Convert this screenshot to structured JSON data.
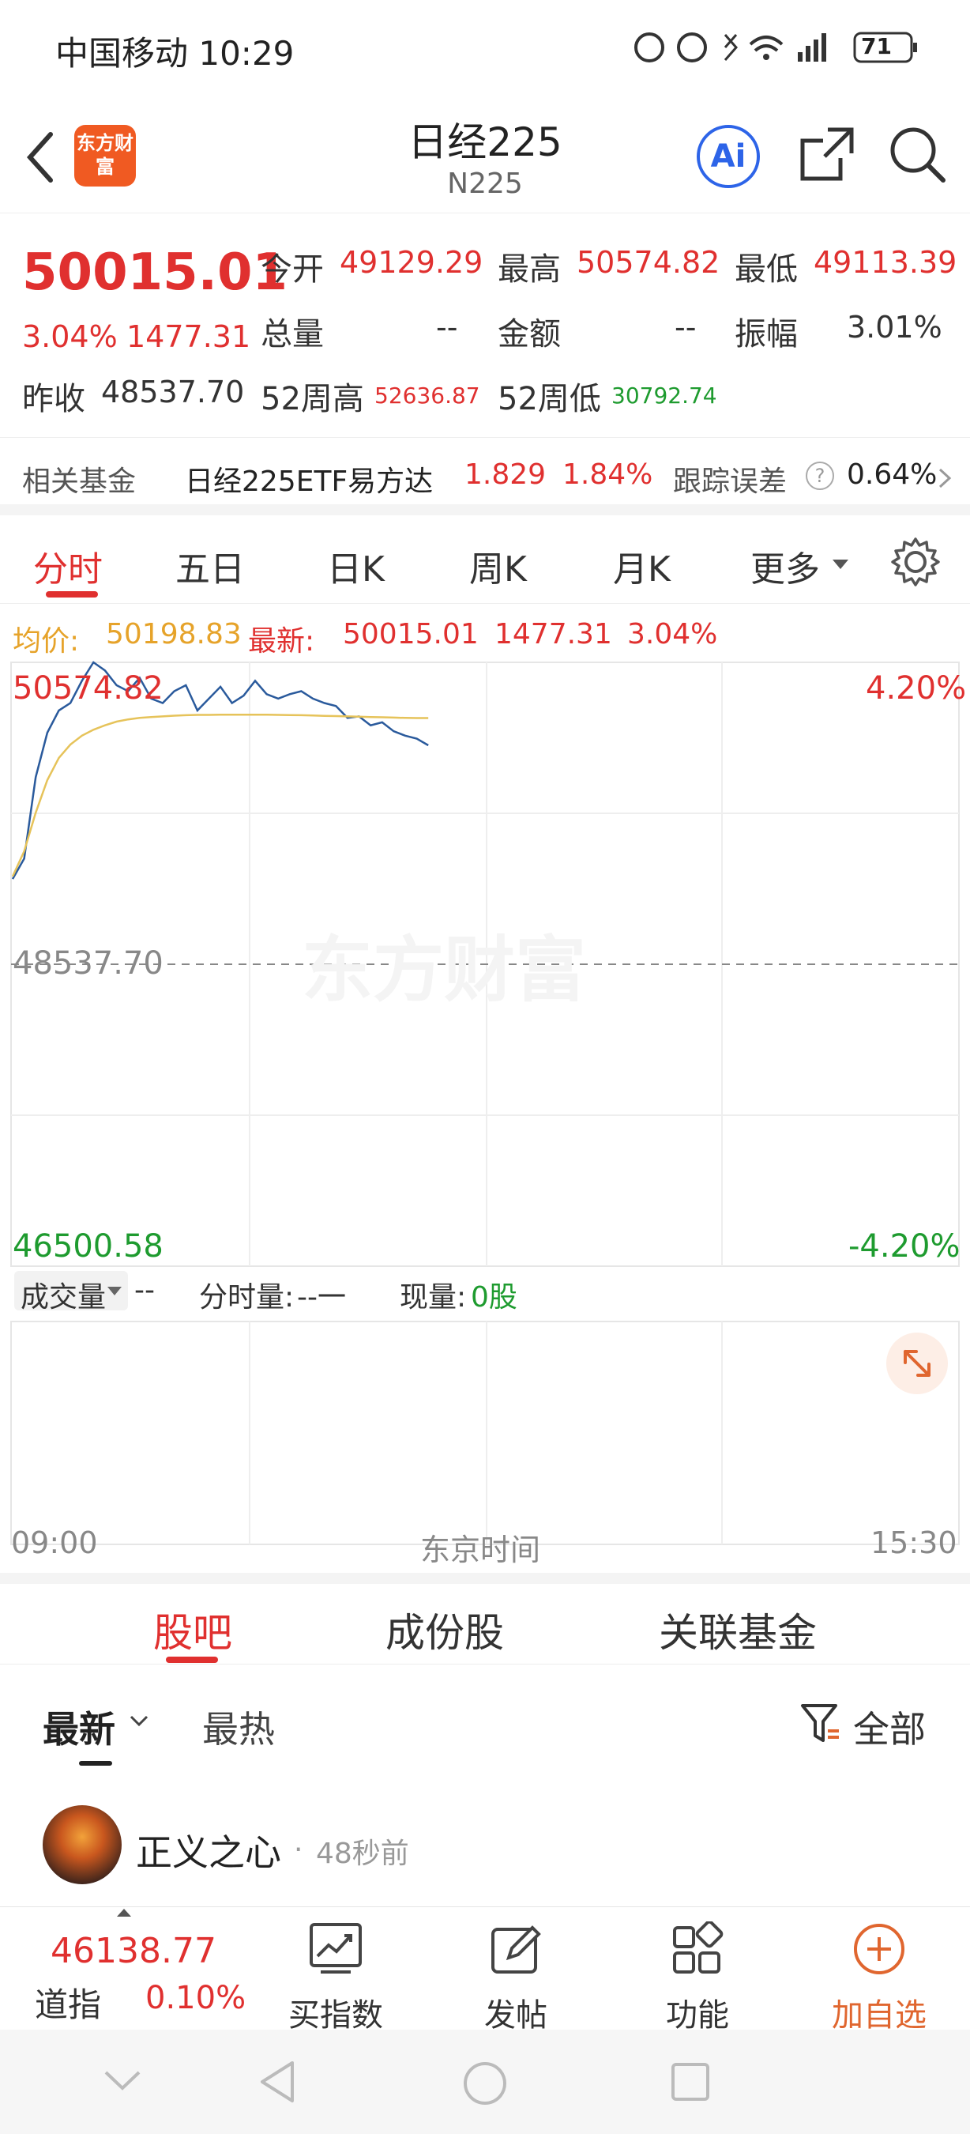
{
  "status_bar": {
    "carrier_time": "中国移动 10:29",
    "battery": "71"
  },
  "header": {
    "title": "日经225",
    "subtitle": "N225",
    "logo_text": "东方财富"
  },
  "quote": {
    "price": "50015.01",
    "change_pct": "3.04%",
    "change": "1477.31",
    "prev_close_label": "昨收",
    "prev_close": "48537.70",
    "open_label": "今开",
    "open": "49129.29",
    "high_label": "最高",
    "high": "50574.82",
    "low_label": "最低",
    "low": "49113.39",
    "volume_label": "总量",
    "volume": "--",
    "amount_label": "金额",
    "amount": "--",
    "amplitude_label": "振幅",
    "amplitude": "3.01%",
    "w52_high_label": "52周高",
    "w52_high": "52636.87",
    "w52_low_label": "52周低",
    "w52_low": "30792.74"
  },
  "fund": {
    "label": "相关基金",
    "name": "日经225ETF易方达",
    "price": "1.829",
    "pct": "1.84%",
    "track_label": "跟踪误差",
    "track_val": "0.64%"
  },
  "tabs": [
    "分时",
    "五日",
    "日K",
    "周K",
    "月K",
    "更多"
  ],
  "chart_head": {
    "avg_label": "均价:",
    "avg_val": "50198.83",
    "latest_label": "最新:",
    "latest_val": "50015.01",
    "latest_chg": "1477.31",
    "latest_pct": "3.04%"
  },
  "chart_labels": {
    "top_left": "50574.82",
    "top_right": "4.20%",
    "mid": "48537.70",
    "bottom_left": "46500.58",
    "bottom_right": "-4.20%",
    "watermark": "东方财富",
    "vol_selector": "成交量",
    "vol_val": "--",
    "tick_vol_label": "分时量:",
    "tick_vol_val": "--一",
    "cur_vol_label": "现量:",
    "cur_vol_val": "0股",
    "time_start": "09:00",
    "time_mid": "东京时间",
    "time_end": "15:30"
  },
  "chart_data": {
    "type": "line",
    "title": "",
    "ylim": [
      46500.58,
      50574.82
    ],
    "prev_close": 48537.7,
    "x": [
      "09:00",
      "15:30"
    ],
    "series": [
      {
        "name": "最新",
        "values": [
          49113,
          49250,
          49800,
          50100,
          50250,
          50300,
          50450,
          50575,
          50520,
          50420,
          50380,
          50470,
          50330,
          50300,
          50380,
          50420,
          50250,
          50330,
          50410,
          50300,
          50350,
          50450,
          50360,
          50330,
          50360,
          50380,
          50330,
          50300,
          50280,
          50200,
          50210,
          50150,
          50170,
          50110,
          50080,
          50060,
          50015
        ]
      },
      {
        "name": "均价",
        "values": [
          49130,
          49300,
          49560,
          49780,
          49930,
          50020,
          50080,
          50120,
          50150,
          50175,
          50190,
          50200,
          50205,
          50210,
          50215,
          50218,
          50220,
          50220,
          50222,
          50222,
          50222,
          50222,
          50221,
          50220,
          50219,
          50218,
          50216,
          50214,
          50212,
          50210,
          50208,
          50206,
          50204,
          50202,
          50200,
          50199,
          50198.83
        ]
      }
    ]
  },
  "sub_tabs": [
    "股吧",
    "成份股",
    "关联基金"
  ],
  "filters": {
    "latest": "最新",
    "hot": "最热",
    "all": "全部"
  },
  "post": {
    "user": "正义之心",
    "time": "48秒前"
  },
  "bottom_bar": {
    "index_val": "46138.77",
    "index_name": "道指",
    "index_pct": "0.10%",
    "buy": "买指数",
    "post": "发帖",
    "func": "功能",
    "add": "加自选"
  }
}
